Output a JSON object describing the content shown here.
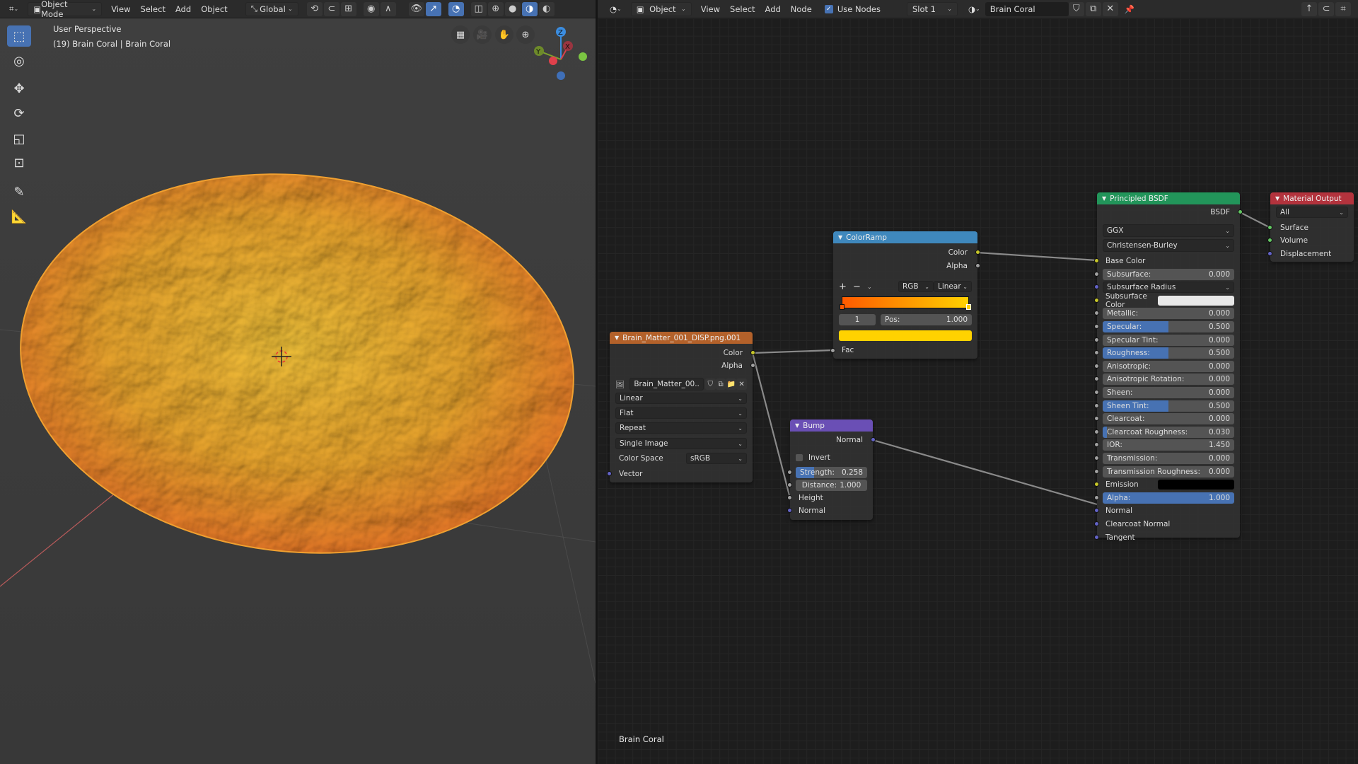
{
  "viewport_header": {
    "mode": "Object Mode",
    "menus": [
      "View",
      "Select",
      "Add",
      "Object"
    ],
    "orientation": "Global"
  },
  "viewport": {
    "view_name": "User Perspective",
    "object_info": "(19) Brain Coral | Brain Coral",
    "gizmo": {
      "z": "Z",
      "x": "X",
      "y": "Y"
    }
  },
  "node_header": {
    "object_type": "Object",
    "menus": [
      "View",
      "Select",
      "Add",
      "Node"
    ],
    "use_nodes_label": "Use Nodes",
    "use_nodes": true,
    "slot": "Slot 1",
    "material_name": "Brain Coral"
  },
  "node_editor": {
    "material_label": "Brain Coral"
  },
  "colors": {
    "accent": "#4772b3",
    "image_header": "#b3612a",
    "colorramp_header": "#3f88bd",
    "bump_header": "#6a4fb5",
    "bsdf_header": "#22955a",
    "output_header": "#b3333d",
    "ramp_start": "#ff5a00",
    "ramp_end": "#ffd200"
  },
  "image_node": {
    "title": "Brain_Matter_001_DISP.png.001",
    "outputs": [
      "Color",
      "Alpha"
    ],
    "image_name": "Brain_Matter_00..",
    "interpolation": "Linear",
    "projection": "Flat",
    "extension": "Repeat",
    "source": "Single Image",
    "color_space_label": "Color Space",
    "color_space": "sRGB",
    "input": "Vector"
  },
  "colorramp": {
    "title": "ColorRamp",
    "outputs": [
      "Color",
      "Alpha"
    ],
    "color_mode": "RGB",
    "interpolation": "Linear",
    "stop_index": "1",
    "pos_label": "Pos:",
    "pos_value": "1.000",
    "input": "Fac",
    "add": "+",
    "remove": "−"
  },
  "bump": {
    "title": "Bump",
    "output": "Normal",
    "invert_label": "Invert",
    "invert": false,
    "strength_label": "Strength:",
    "strength": "0.258",
    "strength_fill": 0.258,
    "distance_label": "Distance:",
    "distance": "1.000",
    "inputs": [
      "Height",
      "Normal"
    ]
  },
  "principled": {
    "title": "Principled BSDF",
    "output": "BSDF",
    "distribution": "GGX",
    "subsurface_method": "Christensen-Burley",
    "inputs": [
      {
        "label": "Base Color",
        "type": "label",
        "socket": "y"
      },
      {
        "label": "Subsurface:",
        "type": "slider",
        "value": "0.000",
        "fill": 0,
        "socket": "g"
      },
      {
        "label": "Subsurface Radius",
        "type": "select",
        "socket": "p"
      },
      {
        "label": "Subsurface Color",
        "type": "color",
        "color": "#e8e8e8",
        "socket": "y"
      },
      {
        "label": "Metallic:",
        "type": "slider",
        "value": "0.000",
        "fill": 0,
        "socket": "g"
      },
      {
        "label": "Specular:",
        "type": "slider",
        "value": "0.500",
        "fill": 0.5,
        "socket": "g"
      },
      {
        "label": "Specular Tint:",
        "type": "slider",
        "value": "0.000",
        "fill": 0,
        "socket": "g"
      },
      {
        "label": "Roughness:",
        "type": "slider",
        "value": "0.500",
        "fill": 0.5,
        "socket": "g"
      },
      {
        "label": "Anisotropic:",
        "type": "slider",
        "value": "0.000",
        "fill": 0,
        "socket": "g"
      },
      {
        "label": "Anisotropic Rotation:",
        "type": "slider",
        "value": "0.000",
        "fill": 0,
        "socket": "g"
      },
      {
        "label": "Sheen:",
        "type": "slider",
        "value": "0.000",
        "fill": 0,
        "socket": "g"
      },
      {
        "label": "Sheen Tint:",
        "type": "slider",
        "value": "0.500",
        "fill": 0.5,
        "socket": "g"
      },
      {
        "label": "Clearcoat:",
        "type": "slider",
        "value": "0.000",
        "fill": 0,
        "socket": "g"
      },
      {
        "label": "Clearcoat Roughness:",
        "type": "slider",
        "value": "0.030",
        "fill": 0.03,
        "socket": "g"
      },
      {
        "label": "IOR:",
        "type": "slider",
        "value": "1.450",
        "fill": 0,
        "socket": "g"
      },
      {
        "label": "Transmission:",
        "type": "slider",
        "value": "0.000",
        "fill": 0,
        "socket": "g"
      },
      {
        "label": "Transmission Roughness:",
        "type": "slider",
        "value": "0.000",
        "fill": 0,
        "socket": "g"
      },
      {
        "label": "Emission",
        "type": "color",
        "color": "#000000",
        "socket": "y"
      },
      {
        "label": "Alpha:",
        "type": "slider",
        "value": "1.000",
        "fill": 1,
        "socket": "g"
      },
      {
        "label": "Normal",
        "type": "label",
        "socket": "p"
      },
      {
        "label": "Clearcoat Normal",
        "type": "label",
        "socket": "p"
      },
      {
        "label": "Tangent",
        "type": "label",
        "socket": "p"
      }
    ]
  },
  "material_output": {
    "title": "Material Output",
    "target": "All",
    "inputs": [
      "Surface",
      "Volume",
      "Displacement"
    ]
  }
}
